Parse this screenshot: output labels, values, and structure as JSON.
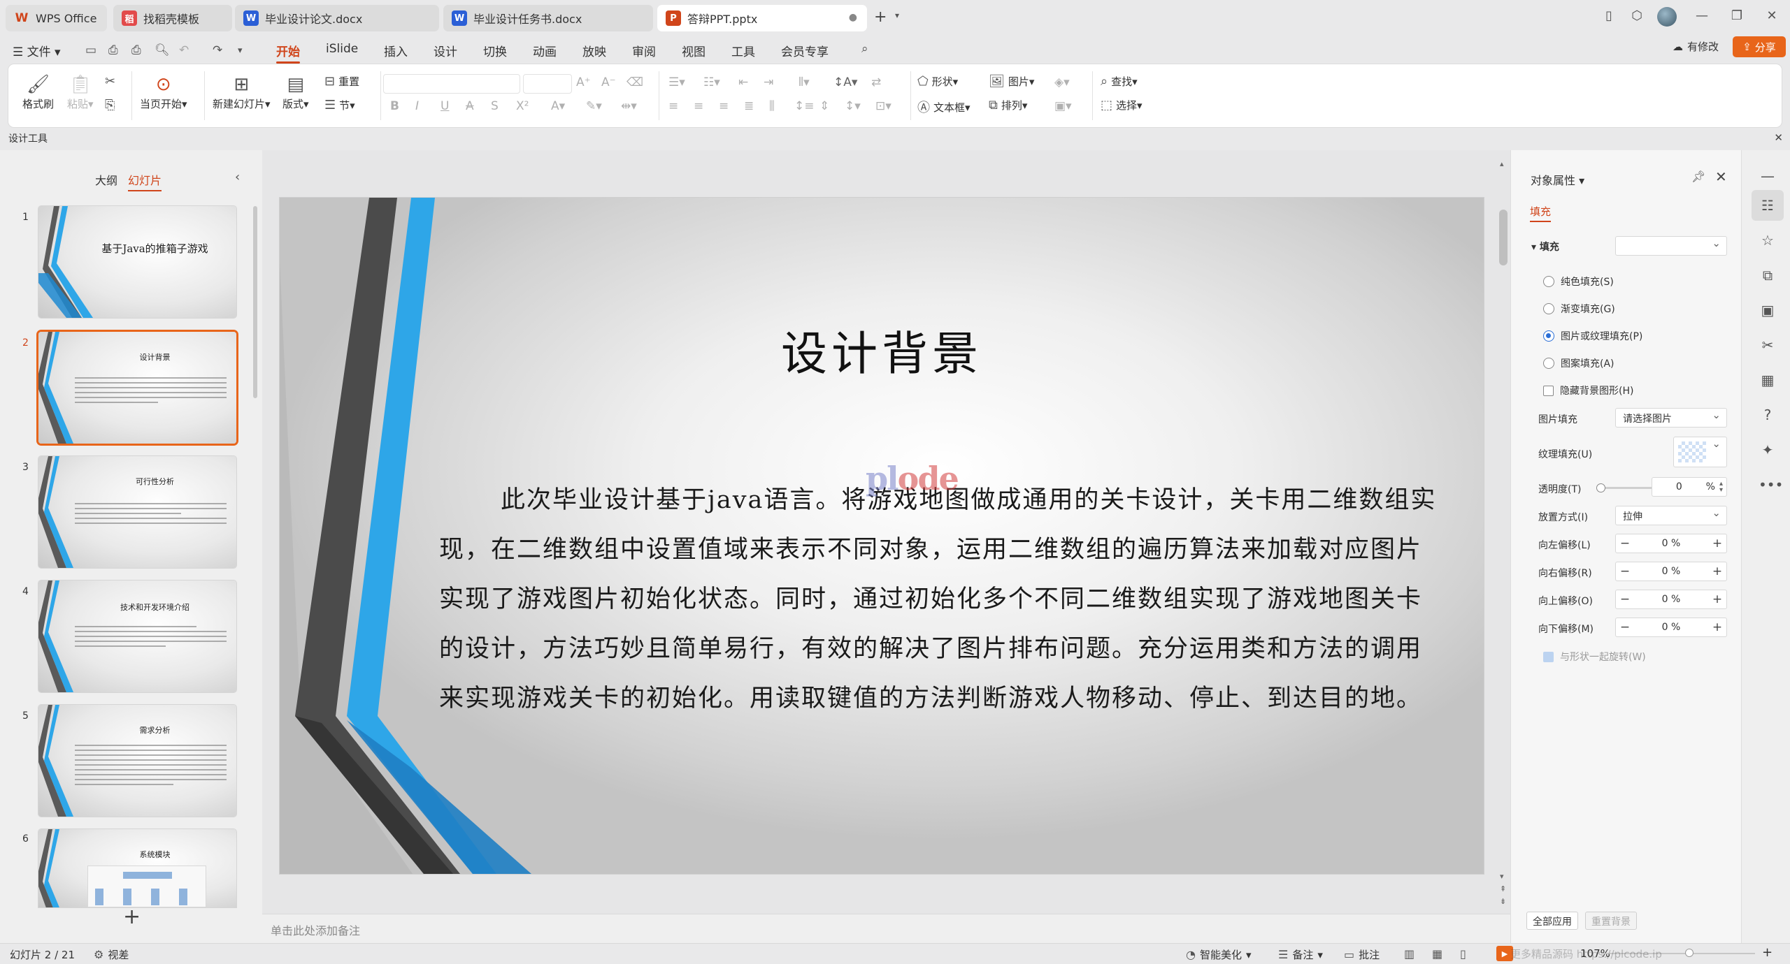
{
  "tabs": [
    {
      "label": "WPS Office",
      "icon": "W",
      "color": "#d0451b"
    },
    {
      "label": "找稻壳模板",
      "icon": "稻",
      "color": "#e24a4a"
    },
    {
      "label": "毕业设计论文.docx",
      "icon": "W",
      "color": "#2b5fd6"
    },
    {
      "label": "毕业设计任务书.docx",
      "icon": "W",
      "color": "#2b5fd6"
    },
    {
      "label": "答辩PPT.pptx",
      "icon": "P",
      "color": "#d0451b"
    }
  ],
  "menu": {
    "file": "文件",
    "items": [
      "开始",
      "iSlide",
      "插入",
      "设计",
      "切换",
      "动画",
      "放映",
      "审阅",
      "视图",
      "工具",
      "会员专享"
    ],
    "has_changes": "有修改",
    "share": "分享"
  },
  "ribbon": {
    "format_painter": "格式刷",
    "paste": "粘贴",
    "play_from_current": "当页开始",
    "new_slide": "新建幻灯片",
    "layout": "版式",
    "reset": "重置",
    "section": "节",
    "shape": "形状",
    "picture": "图片",
    "textbox": "文本框",
    "arrange": "排列",
    "find": "查找",
    "select": "选择"
  },
  "design_tools": "设计工具",
  "left_panel": {
    "tab_outline": "大纲",
    "tab_slides": "幻灯片",
    "slides": [
      {
        "num": "1",
        "title": "基于Java的推箱子游戏"
      },
      {
        "num": "2",
        "title": "设计背景"
      },
      {
        "num": "3",
        "title": "可行性分析"
      },
      {
        "num": "4",
        "title": "技术和开发环境介绍"
      },
      {
        "num": "5",
        "title": "需求分析"
      },
      {
        "num": "6",
        "title": "系统模块"
      }
    ]
  },
  "slide": {
    "title": "设计背景",
    "body": "此次毕业设计基于java语言。将游戏地图做成通用的关卡设计，关卡用二维数组实现，在二维数组中设置值域来表示不同对象，运用二维数组的遍历算法来加载对应图片实现了游戏图片初始化状态。同时，通过初始化多个不同二维数组实现了游戏地图关卡的设计，方法巧妙且简单易行，有效的解决了图片排布问题。充分运用类和方法的调用来实现游戏关卡的初始化。用读取键值的方法判断游戏人物移动、停止、到达目的地。",
    "watermark_a": "pl",
    "watermark_b": "ode"
  },
  "notes_placeholder": "单击此处添加备注",
  "props": {
    "title": "对象属性",
    "tab_fill": "填充",
    "section_fill": "填充",
    "options": [
      "纯色填充(S)",
      "渐变填充(G)",
      "图片或纹理填充(P)",
      "图案填充(A)"
    ],
    "selected_option": 2,
    "hide_bg": "隐藏背景图形(H)",
    "picture_fill_label": "图片填充",
    "picture_fill_value": "请选择图片",
    "texture_label": "纹理填充(U)",
    "transparency_label": "透明度(T)",
    "transparency_value": "0",
    "percent": "%",
    "placement_label": "放置方式(I)",
    "placement_value": "拉伸",
    "offsets": [
      {
        "label": "向左偏移(L)",
        "value": "0"
      },
      {
        "label": "向右偏移(R)",
        "value": "0"
      },
      {
        "label": "向上偏移(O)",
        "value": "0"
      },
      {
        "label": "向下偏移(M)",
        "value": "0"
      }
    ],
    "rotate_with_shape": "与形状一起旋转(W)",
    "apply_all": "全部应用",
    "reset_bg": "重置背景"
  },
  "status": {
    "slide_pos": "幻灯片 2 / 21",
    "view_label": "视差",
    "smart_beautify": "智能美化",
    "notes": "备注",
    "comment": "批注",
    "zoom": "107%",
    "csdn_watermark": "更多精品源码 https://plcode.ip"
  }
}
